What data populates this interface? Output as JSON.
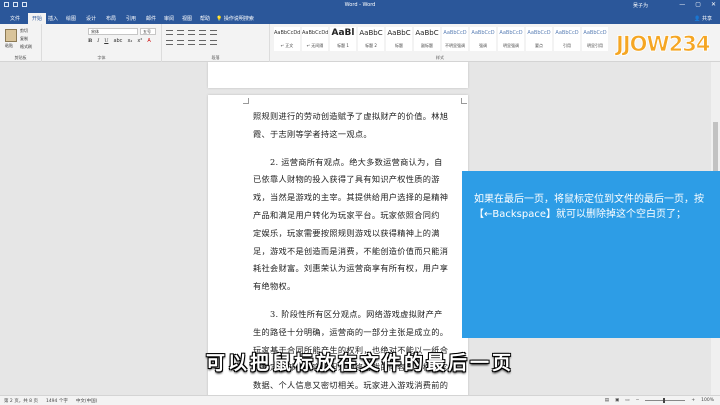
{
  "titlebar": {
    "title": "Word - Word",
    "user": "吴子为",
    "minimize": "—",
    "maximize": "▢",
    "close": "✕"
  },
  "tabs": [
    {
      "label": "文件"
    },
    {
      "label": "开始"
    },
    {
      "label": "插入"
    },
    {
      "label": "绘图"
    },
    {
      "label": "设计"
    },
    {
      "label": "布局"
    },
    {
      "label": "引用"
    },
    {
      "label": "邮件"
    },
    {
      "label": "审阅"
    },
    {
      "label": "视图"
    },
    {
      "label": "帮助"
    }
  ],
  "tellme": "操作说明搜索",
  "share": "共享",
  "ribbon": {
    "paste": "粘贴",
    "cut": "剪切",
    "copy": "复制",
    "format_painter": "格式刷",
    "font_name": "宋体",
    "font_size": "五号",
    "group_clipboard": "剪贴板",
    "group_font": "字体",
    "group_paragraph": "段落",
    "group_styles": "样式",
    "styles": [
      {
        "sample": "AaBbCcDd",
        "name": "↵ 正文"
      },
      {
        "sample": "AaBbCcDd",
        "name": "↵ 无间隔"
      },
      {
        "sample": "AaBl",
        "name": "标题 1"
      },
      {
        "sample": "AaBbC",
        "name": "标题 2"
      },
      {
        "sample": "AaBbC",
        "name": "标题"
      },
      {
        "sample": "AaBbC",
        "name": "副标题"
      },
      {
        "sample": "AaBbCcD",
        "name": "不明显强调"
      },
      {
        "sample": "AaBbCcD",
        "name": "强调"
      },
      {
        "sample": "AaBbCcD",
        "name": "明显强调"
      },
      {
        "sample": "AaBbCcD",
        "name": "要点"
      },
      {
        "sample": "AaBbCcD",
        "name": "引用"
      },
      {
        "sample": "AaBbCcD",
        "name": "明显引用"
      }
    ]
  },
  "document": {
    "paragraphs": [
      "照规则进行的劳动创造赋予了虚拟财产的价值。林旭",
      "霞、于志刚等学者持这一观点。",
      "",
      "　　2. 运营商所有观点。绝大多数运营商认为，自",
      "已依靠人财物的投入获得了具有知识产权性质的游",
      "戏，当然是游戏的主宰。其提供给用户选择的是精神",
      "产品和满足用户转化为玩家平台。玩家依照合同约",
      "定娱乐，玩家需要按照规则游戏以获得精神上的满",
      "足，游戏不是创造而是消费，不能创造价值而只能消",
      "耗社会财富。刘惠荣认为运营商享有所有权，用户享",
      "有绝物权。",
      "",
      "　　3. 阶段性所有区分观点。网络游戏虚拟财产产",
      "生的路径十分明确，运营商的一部分主张是成立的。",
      "玩家基于合同所能产生的权利，也绝对不能以一纸合",
      "同规定全部的内容，因为网络游戏的内容有大权、它与",
      "数据、个人信息又密切相关。玩家进入游戏消费前的"
    ]
  },
  "tip": "如果在最后一页，将鼠标定位到文件的最后一页，按【←Backspace】就可以删除掉这个空白页了；",
  "subtitle": "可以把鼠标放在文件的最后一页",
  "status": {
    "page": "第 2 页，共 8 页",
    "words": "1494 个字",
    "lang": "中文(中国)",
    "zoom": "100%"
  },
  "logo_text": "JJOW234",
  "colors": {
    "word_blue": "#2b579a",
    "tip_blue": "#2d9de6"
  }
}
